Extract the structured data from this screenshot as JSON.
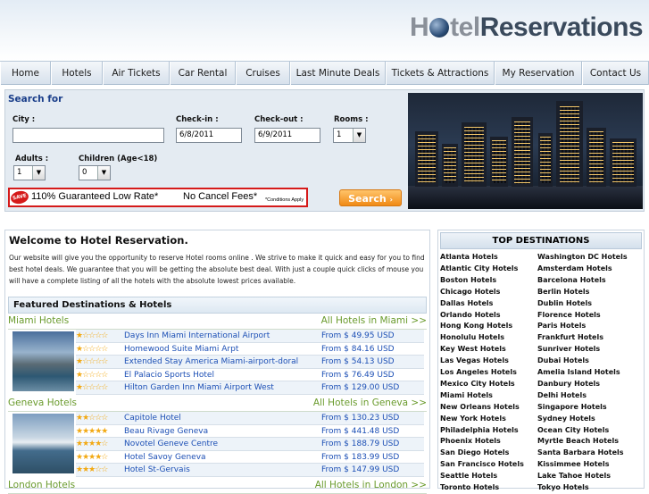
{
  "brand": {
    "logo_text_h": "H",
    "logo_text_rest": "tel",
    "logo_text_brand": "Reservations"
  },
  "nav": [
    "Home",
    "Hotels",
    "Air Tickets",
    "Car Rental",
    "Cruises",
    "Last Minute Deals",
    "Tickets & Attractions",
    "My Reservation",
    "Contact Us"
  ],
  "search": {
    "title": "Search for",
    "city_label": "City :",
    "city_value": "",
    "checkin_label": "Check-in :",
    "checkin_value": "6/8/2011",
    "checkout_label": "Check-out :",
    "checkout_value": "6/9/2011",
    "rooms_label": "Rooms :",
    "rooms_value": "1",
    "adults_label": "Adults :",
    "adults_value": "1",
    "children_label": "Children (Age<18)",
    "children_value": "0",
    "save_badge": "SAVE",
    "guarantee": "110% Guaranteed Low Rate*",
    "no_cancel": "No Cancel Fees*",
    "conditions": "*Conditions Apply",
    "button": "Search"
  },
  "welcome": {
    "title": "Welcome to Hotel Reservation.",
    "text": "Our website will give you the opportunity to reserve Hotel rooms online . We strive to make it quick and easy for you to find best hotel deals. We guarantee that you will be getting the absolute best deal. With just a couple quick clicks of mouse you will have a complete listing of all the hotels with the absolute lowest prices available."
  },
  "featured_title": "Featured Destinations & Hotels",
  "cities": [
    {
      "name": "Miami Hotels",
      "all": "All Hotels in Miami >>",
      "hotels": [
        {
          "name": "Days Inn Miami International Airport",
          "price": "From $ 49.95 USD"
        },
        {
          "name": "Homewood Suite Miami Arpt",
          "price": "From $ 84.16 USD"
        },
        {
          "name": "Extended Stay America Miami-airport-doral",
          "price": "From $ 54.13 USD"
        },
        {
          "name": "El Palacio Sports Hotel",
          "price": "From $ 76.49 USD"
        },
        {
          "name": "Hilton Garden Inn Miami Airport West",
          "price": "From $ 129.00 USD"
        }
      ]
    },
    {
      "name": "Geneva Hotels",
      "all": "All Hotels in Geneva >>",
      "hotels": [
        {
          "name": "Capitole Hotel",
          "price": "From $ 130.23 USD"
        },
        {
          "name": "Beau Rivage Geneva",
          "price": "From $ 441.48 USD"
        },
        {
          "name": "Novotel Geneve Centre",
          "price": "From $ 188.79 USD"
        },
        {
          "name": "Hotel Savoy Geneva",
          "price": "From $ 183.99 USD"
        },
        {
          "name": "Hotel St-Gervais",
          "price": "From $ 147.99 USD"
        }
      ]
    },
    {
      "name": "London Hotels",
      "all": "All Hotels in London >>"
    }
  ],
  "top_destinations": {
    "title": "TOP DESTINATIONS",
    "left": [
      "Atlanta Hotels",
      "Atlantic City Hotels",
      "Boston Hotels",
      "Chicago Hotels",
      "Dallas Hotels",
      "Orlando Hotels",
      "Hong Kong Hotels",
      "Honolulu Hotels",
      "Key West Hotels",
      "Las Vegas Hotels",
      "Los Angeles Hotels",
      "Mexico City Hotels",
      "Miami Hotels",
      "New Orleans Hotels",
      "New York Hotels",
      "Philadelphia Hotels",
      "Phoenix Hotels",
      "San Diego Hotels",
      "San Francisco Hotels",
      "Seattle Hotels",
      "Toronto Hotels"
    ],
    "right": [
      "Washington DC Hotels",
      "Amsterdam Hotels",
      "Barcelona Hotels",
      "Berlin Hotels",
      "Dublin Hotels",
      "Florence Hotels",
      "Paris Hotels",
      "Frankfurt Hotels",
      "Sunriver Hotels",
      "Dubai Hotels",
      "Amelia Island Hotels",
      "Danbury Hotels",
      "Delhi Hotels",
      "Singapore Hotels",
      "Sydney Hotels",
      "Ocean City Hotels",
      "Myrtle Beach Hotels",
      "Santa Barbara Hotels",
      "Kissimmee Hotels",
      "Lake Tahoe Hotels",
      "Tokyo Hotels"
    ]
  },
  "colors": {
    "accent_blue": "#1c4fb5",
    "green_city": "#6a9b2d",
    "orange_button": "#f08a16",
    "red_border": "#d51a1a"
  }
}
